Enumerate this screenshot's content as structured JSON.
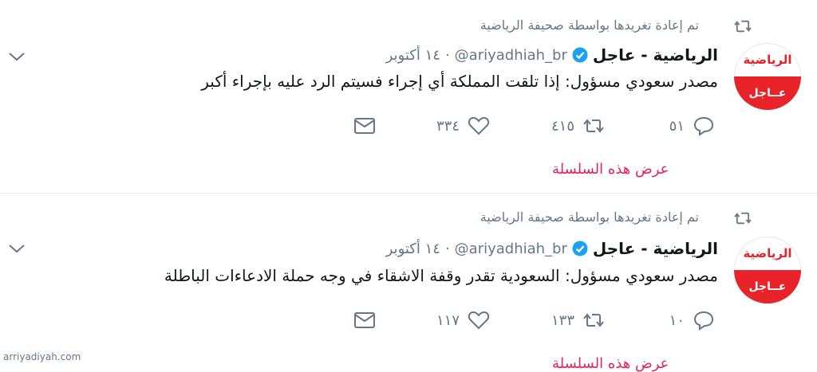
{
  "tweets": [
    {
      "retweet_by": "تم إعادة تغريدها بواسطة صحيفة الرياضية",
      "avatar_top": "الرياضية",
      "avatar_bottom": "عــاجل",
      "name": "الرياضية - عاجل",
      "handle": "@ariyadhiah_br",
      "separator": "·",
      "time": "١٤ أكتوبر",
      "text": "مصدر سعودي مسؤول: إذا تلقت المملكة أي إجراء فسيتم الرد عليه بإجراء أكبر",
      "replies": "٥١",
      "retweets": "٤١٥",
      "likes": "٣٣٤",
      "thread_link": "عرض هذه السلسلة"
    },
    {
      "retweet_by": "تم إعادة تغريدها بواسطة صحيفة الرياضية",
      "avatar_top": "الرياضية",
      "avatar_bottom": "عــاجل",
      "name": "الرياضية - عاجل",
      "handle": "@ariyadhiah_br",
      "separator": "·",
      "time": "١٤ أكتوبر",
      "text": "مصدر سعودي مسؤول: السعودية تقدر وقفة الاشقاء في وجه حملة الادعاءات الباطلة",
      "replies": "١٠",
      "retweets": "١٣٣",
      "likes": "١١٧",
      "thread_link": "عرض هذه السلسلة"
    }
  ],
  "colors": {
    "accent_red": "#e0245e",
    "brand_red": "#e8232a",
    "verified_blue": "#1da1f2",
    "muted": "#657786"
  },
  "icons": [
    "retweet-icon",
    "verified-icon",
    "reply-icon",
    "like-icon",
    "dm-icon",
    "chevron-down-icon"
  ],
  "watermark": "arriyadiyah.com"
}
